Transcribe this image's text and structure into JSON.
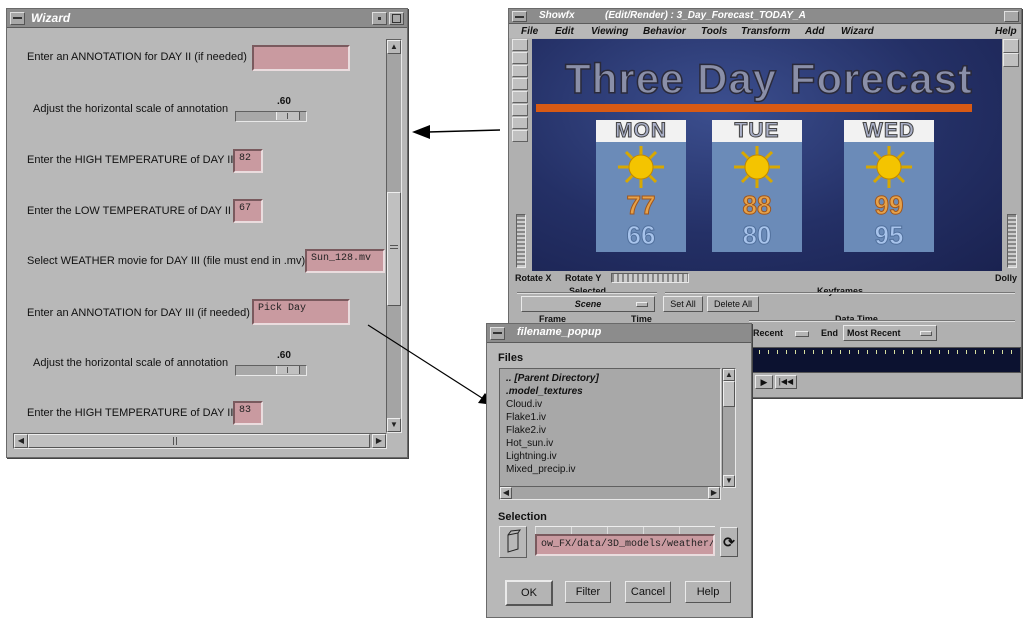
{
  "wizard": {
    "title": "Wizard",
    "rows": [
      {
        "label": "Enter an ANNOTATION for DAY  II (if needed)",
        "value": ""
      },
      {
        "label": "Adjust the horizontal scale of annotation",
        "slider_value": ".60",
        "slider_fraction": 0.6
      },
      {
        "label": "Enter the HIGH TEMPERATURE of DAY  II",
        "value": "82"
      },
      {
        "label": "Enter the LOW TEMPERATURE of DAY  II",
        "value": "67"
      },
      {
        "label": "Select WEATHER movie for DAY III (file must end in .mv)",
        "value": "Sun_128.mv"
      },
      {
        "label": "Enter an ANNOTATION for DAY III (if needed)",
        "value": "Pick Day"
      },
      {
        "label": "Adjust the horizontal scale of annotation",
        "slider_value": ".60",
        "slider_fraction": 0.6
      },
      {
        "label": "Enter the HIGH TEMPERATURE of DAY III",
        "value": "83"
      }
    ]
  },
  "showfx": {
    "app_name": "Showfx",
    "title": "(Edit/Render) : 3_Day_Forecast_TODAY_A",
    "menu": [
      "File",
      "Edit",
      "Viewing",
      "Behavior",
      "Tools",
      "Transform",
      "Add",
      "Wizard",
      "Help"
    ],
    "forecast_title": "Three Day Forecast",
    "days": [
      {
        "name": "MON",
        "high": "77",
        "low": "66"
      },
      {
        "name": "TUE",
        "high": "88",
        "low": "80"
      },
      {
        "name": "WED",
        "high": "99",
        "low": "95"
      }
    ],
    "rotate_x": "Rotate X",
    "rotate_y": "Rotate Y",
    "dolly": "Dolly",
    "selected_label": "Selected",
    "selected_value": "Scene",
    "keyframes_label": "Keyframes",
    "set_all": "Set All",
    "delete_all": "Delete All",
    "frame_label": "Frame",
    "time_label": "Time",
    "data_time_label": "Data Time",
    "start_value": "Recent",
    "end_label": "End",
    "end_value": "Most Recent"
  },
  "filename_popup": {
    "title": "filename_popup",
    "files_label": "Files",
    "files": [
      {
        "name": "..  [Parent Directory]",
        "style": "dir"
      },
      {
        "name": ".model_textures",
        "style": "dir"
      },
      {
        "name": "Cloud.iv",
        "style": "file"
      },
      {
        "name": "Flake1.iv",
        "style": "file"
      },
      {
        "name": "Flake2.iv",
        "style": "file"
      },
      {
        "name": "Hot_sun.iv",
        "style": "file"
      },
      {
        "name": "Lightning.iv",
        "style": "file"
      },
      {
        "name": "Mixed_precip.iv",
        "style": "file"
      }
    ],
    "selection_label": "Selection",
    "selection_value": "ow_FX/data/3D_models/weather/",
    "ok": "OK",
    "filter": "Filter",
    "cancel": "Cancel",
    "help": "Help"
  },
  "colors": {
    "field_pink": "#c99aa0",
    "window_gray": "#b8b8b8",
    "titlebar_gray": "#8c8c8c",
    "forecast_bg": "#2a3770",
    "forecast_title": "#8a8fa8",
    "orange_bar": "#d85a14"
  }
}
